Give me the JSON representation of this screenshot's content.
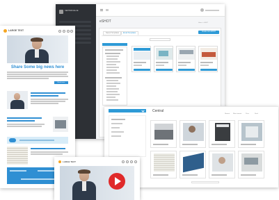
{
  "eshot": {
    "brand": "CENTRALVALUE",
    "title": "eSHOT",
    "tabs": [
      "Saved Templates",
      "Email Templates"
    ],
    "create_button": "Create new eSHOT",
    "breadcrumb": "Home > eSHOT"
  },
  "central": {
    "title": "Central",
    "sort_options": [
      "Newest",
      "Most viewed",
      "Price",
      "Stock"
    ]
  },
  "newsletter": {
    "logo": "LARGE TEXT",
    "headline": "Share Some big news here",
    "button": "Read more"
  },
  "newsletter2": {
    "logo": "LARGE TEXT"
  },
  "colors": {
    "accent": "#2e9ad6",
    "sidebar": "#2d3035",
    "play": "#e02a2a",
    "logo": "#f5a623"
  }
}
